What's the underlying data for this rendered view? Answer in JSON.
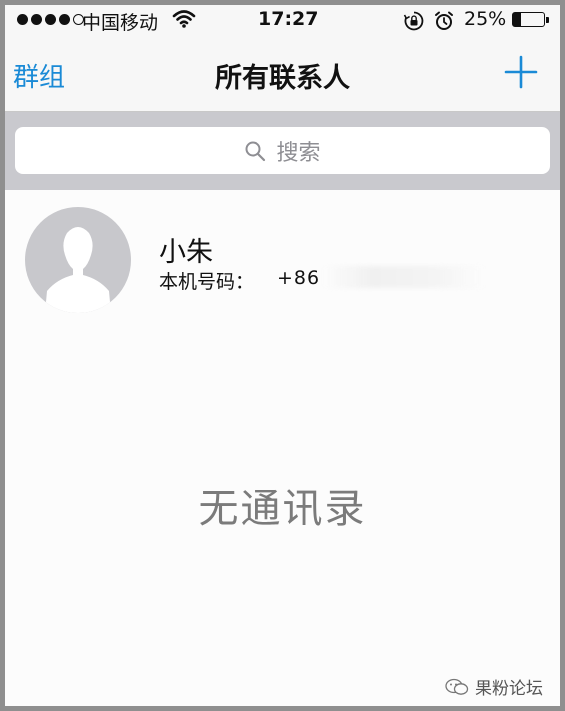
{
  "status_bar": {
    "carrier": "中国移动",
    "time": "17:27",
    "battery_percent": "25%",
    "battery_level": 0.25,
    "signal_bars_filled": 4,
    "signal_bars_total": 5
  },
  "nav": {
    "left_label": "群组",
    "title": "所有联系人",
    "add_icon": "plus-icon"
  },
  "search": {
    "placeholder": "搜索",
    "icon": "search-icon"
  },
  "contact": {
    "name": "小朱",
    "phone_label": "本机号码：",
    "phone": "+86"
  },
  "empty_state": {
    "text": "无通讯录"
  },
  "watermark": {
    "text": "果粉论坛"
  },
  "colors": {
    "accent": "#1a8ad6",
    "bar_background": "#f7f7f7",
    "search_background": "#c9c9ce",
    "avatar_gray": "#c8c8cc"
  }
}
